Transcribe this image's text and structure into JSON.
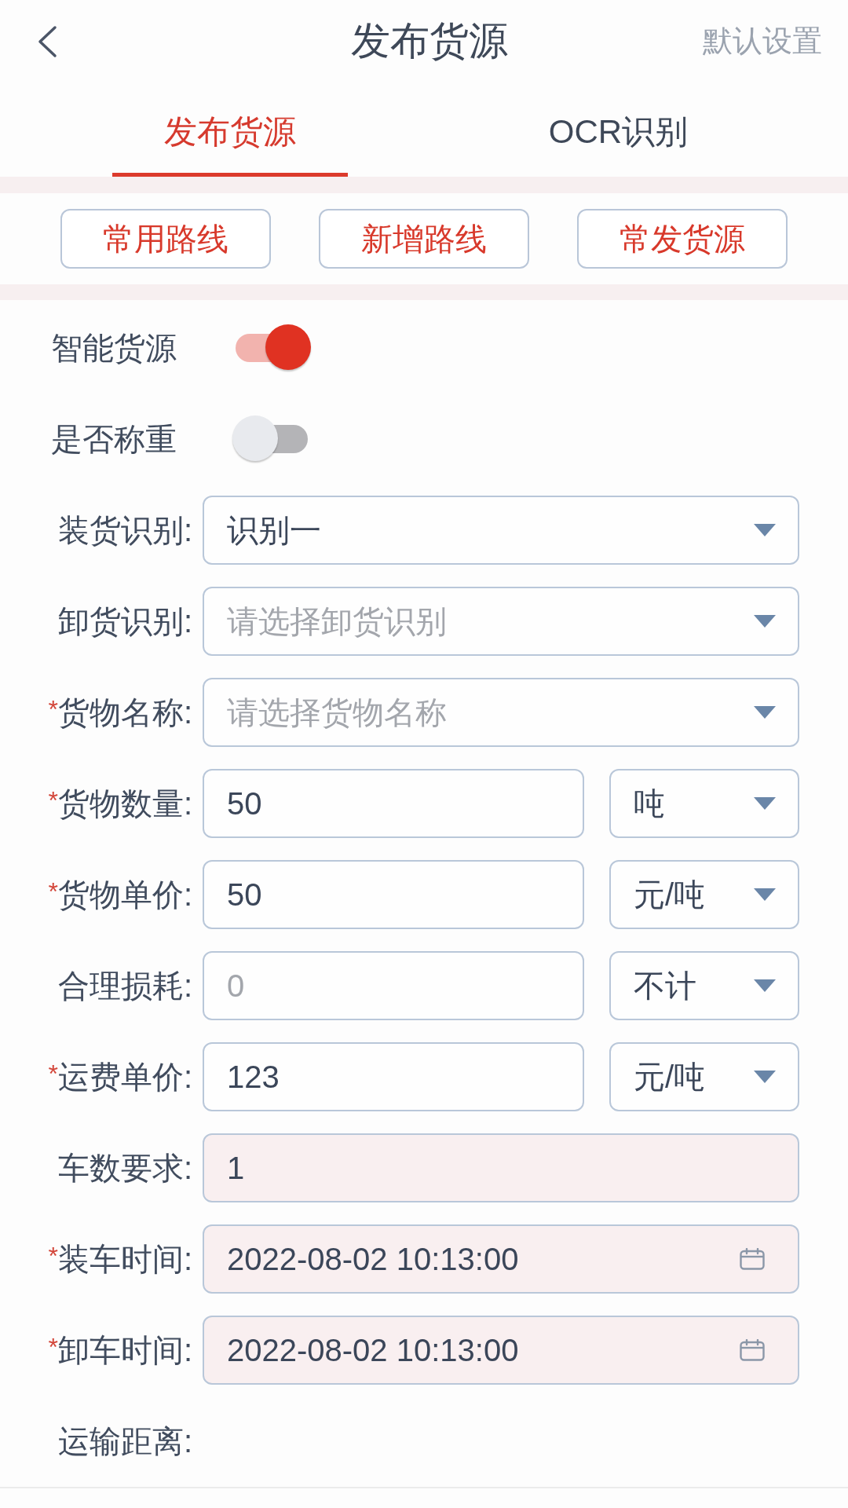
{
  "header": {
    "title": "发布货源",
    "action": "默认设置"
  },
  "tabs": [
    {
      "label": "发布货源",
      "selected": true
    },
    {
      "label": "OCR识别",
      "selected": false
    }
  ],
  "quick_buttons": [
    "常用路线",
    "新增路线",
    "常发货源"
  ],
  "switches": [
    {
      "label": "智能货源",
      "on": true
    },
    {
      "label": "是否称重",
      "on": false
    }
  ],
  "fields": [
    {
      "kind": "select",
      "label": "装货识别:",
      "readonly": false,
      "value": "识别一"
    },
    {
      "kind": "select",
      "label": "卸货识别:",
      "readonly": false,
      "placeholder": "请选择卸货识别"
    },
    {
      "kind": "select",
      "mark": "*",
      "label": "货物名称:",
      "readonly": false,
      "placeholder": "请选择货物名称"
    },
    {
      "kind": "input_unit",
      "mark": "*",
      "label": "货物数量:",
      "readonly": false,
      "value": "50",
      "unit": "吨"
    },
    {
      "kind": "input_unit",
      "mark": "*",
      "label": "货物单价:",
      "readonly": false,
      "value": "50",
      "unit": "元/吨"
    },
    {
      "kind": "input_unit",
      "label": "合理损耗:",
      "readonly": false,
      "placeholder": "0",
      "unit": "不计"
    },
    {
      "kind": "input_unit",
      "mark": "*",
      "label": "运费单价:",
      "readonly": false,
      "value": "123",
      "unit": "元/吨"
    },
    {
      "kind": "input",
      "label": "车数要求:",
      "readonly": true,
      "value": "1"
    },
    {
      "kind": "date",
      "mark": "*",
      "label": "装车时间:",
      "readonly": true,
      "value": "2022-08-02 10:13:00"
    },
    {
      "kind": "date",
      "mark": "*",
      "label": "卸车时间:",
      "readonly": true,
      "value": "2022-08-02 10:13:00"
    },
    {
      "kind": "text",
      "label": "运输距离:"
    }
  ]
}
